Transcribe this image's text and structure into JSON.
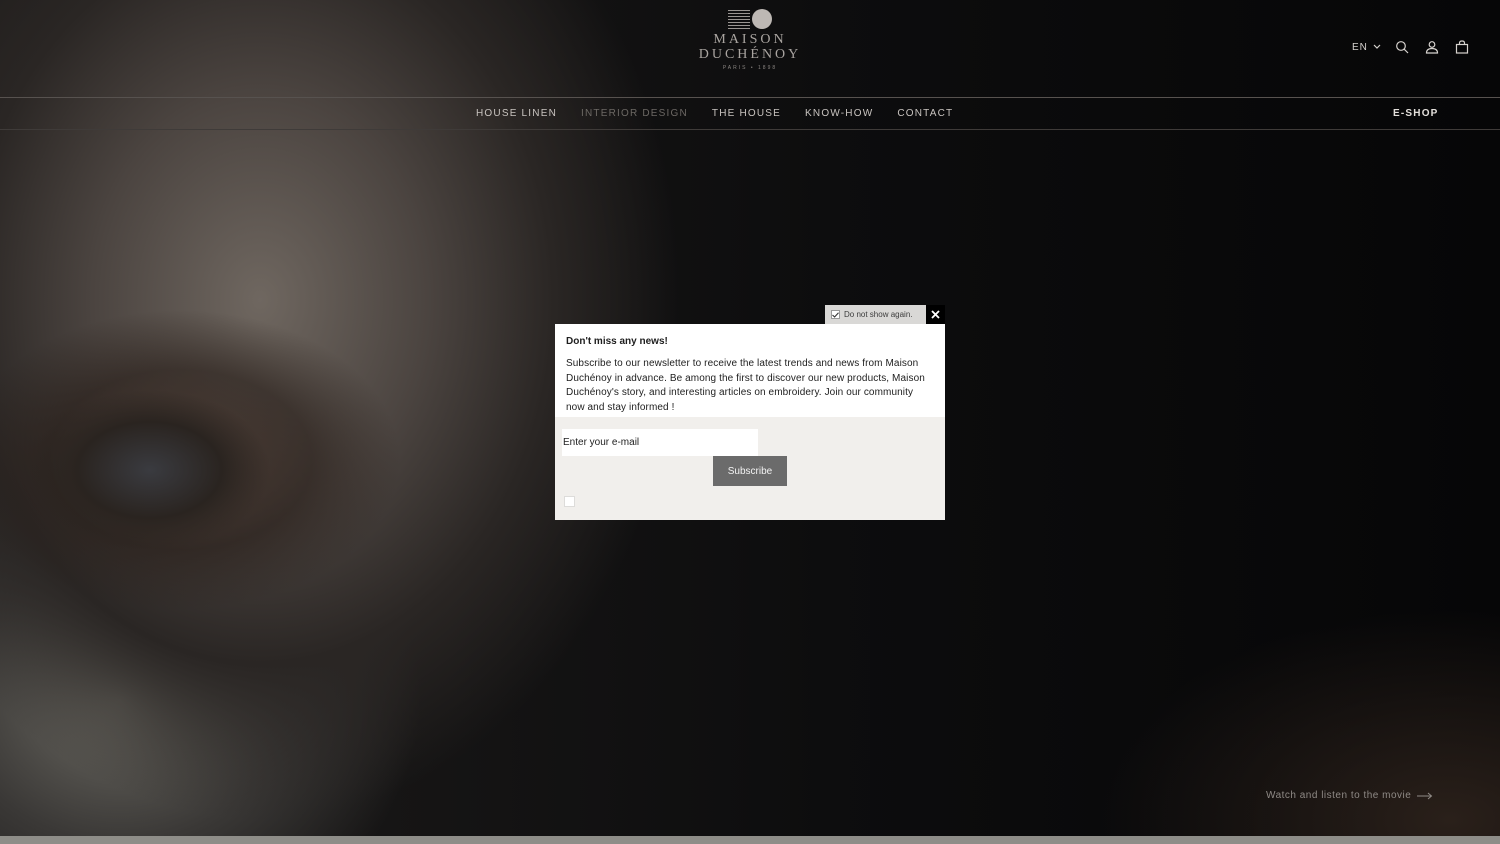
{
  "brand": {
    "line1": "MAISON",
    "line2": "DUCHÉNOY",
    "tagline": "PARIS • 1898"
  },
  "header": {
    "language": "EN",
    "icons": [
      "search-icon",
      "account-icon",
      "bag-icon"
    ]
  },
  "nav": {
    "items": [
      {
        "label": "HOUSE LINEN"
      },
      {
        "label": "INTERIOR DESIGN"
      },
      {
        "label": "THE HOUSE"
      },
      {
        "label": "KNOW-HOW"
      },
      {
        "label": "CONTACT"
      }
    ],
    "eshop": "E-SHOP"
  },
  "hero": {
    "movie_link": "Watch and listen to the movie"
  },
  "popup": {
    "do_not_show": "Do not show again.",
    "do_not_show_checked": true,
    "title": "Don't miss any news!",
    "body": "Subscribe to our newsletter to receive the latest trends and news from Maison Duchénoy in advance. Be among the first to discover our new products, Maison Duchénoy's story, and interesting articles on embroidery. Join our community now and stay informed !",
    "email_placeholder": "Enter your e-mail",
    "subscribe_label": "Subscribe"
  },
  "colors": {
    "popup_bg": "#f1efec",
    "subscribe_bg": "#6b6b6b",
    "close_bg": "#000000"
  }
}
